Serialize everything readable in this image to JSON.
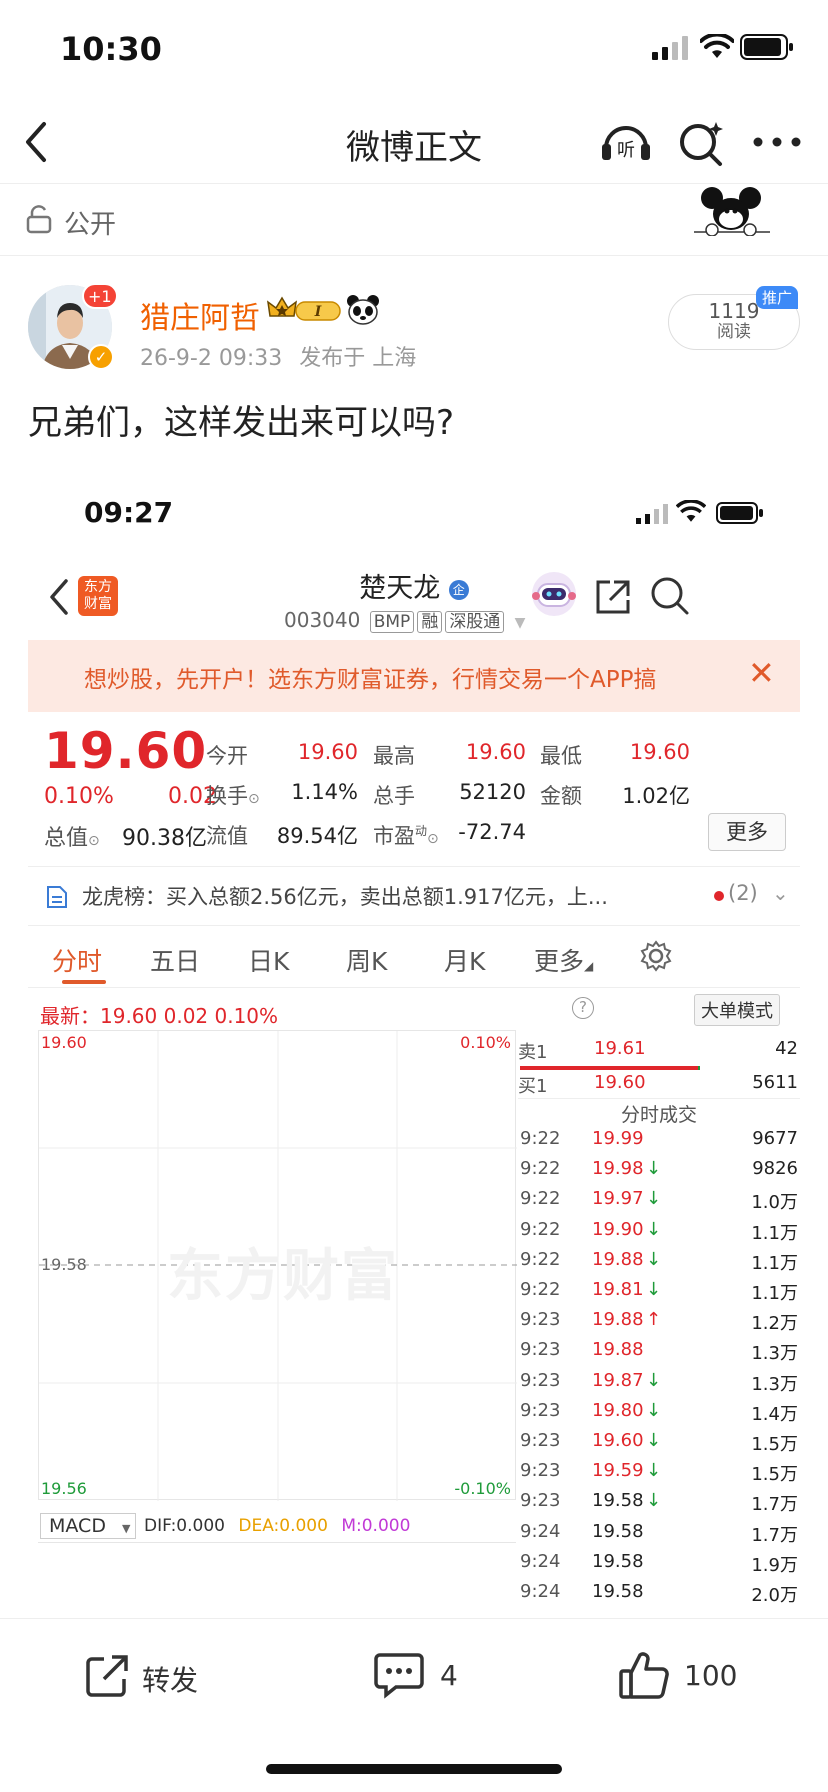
{
  "status_bar": {
    "time": "10:30"
  },
  "nav": {
    "title": "微博正文"
  },
  "post": {
    "visibility": "公开",
    "author": "猎庄阿哲",
    "avatar_badge": "+1",
    "timestamp": "26-9-2 09:33",
    "location": "发布于 上海",
    "read_count": "1119",
    "read_label": "阅读",
    "promo_tag": "推广",
    "text": "兄弟们，这样发出来可以吗?"
  },
  "embedded": {
    "status_time": "09:27",
    "stock": {
      "name": "楚天龙",
      "code": "003040",
      "tags": [
        "BMP",
        "融",
        "深股通"
      ],
      "logo_text": "东方财富"
    },
    "banner": {
      "text": "想炒股，先开户！选东方财富证券，行情交易一个APP搞",
      "close": "✕"
    },
    "quote": {
      "price": "19.60",
      "pct": "0.10%",
      "change": "0.02",
      "total_value_label": "总值",
      "total_value": "90.38亿",
      "fields": [
        {
          "label": "今开",
          "value": "19.60",
          "color": "#e0262b"
        },
        {
          "label": "最高",
          "value": "19.60",
          "color": "#e0262b"
        },
        {
          "label": "最低",
          "value": "19.60",
          "color": "#e0262b"
        },
        {
          "label": "换手",
          "value": "1.14%",
          "color": "#222222"
        },
        {
          "label": "总手",
          "value": "52120",
          "color": "#222222"
        },
        {
          "label": "金额",
          "value": "1.02亿",
          "color": "#222222"
        },
        {
          "label": "流值",
          "value": "89.54亿",
          "color": "#222222"
        },
        {
          "label": "市盈",
          "value": "-72.74",
          "color": "#222222"
        }
      ],
      "more_button": "更多"
    },
    "dragon_tiger": {
      "text": "龙虎榜：买入总额2.56亿元，卖出总额1.917亿元，上...",
      "count": "(2)"
    },
    "tabs": [
      "分时",
      "五日",
      "日K",
      "周K",
      "月K",
      "更多"
    ],
    "latest_line": "最新：19.60  0.02  0.10%",
    "big_order_mode": "大单模式",
    "chart_labels": {
      "top_price": "19.60",
      "mid_price": "19.58",
      "bottom_price": "19.56",
      "top_pct": "0.10%",
      "bottom_pct": "-0.10%",
      "watermark": "东方财富"
    },
    "macd": {
      "select": "MACD",
      "dif": "DIF:0.000",
      "dea": "DEA:0.000",
      "m": "M:0.000"
    },
    "order_book": {
      "sell1": {
        "label": "卖1",
        "price": "19.61",
        "volume": "42"
      },
      "buy1": {
        "label": "买1",
        "price": "19.60",
        "volume": "5611"
      }
    },
    "trades_title": "分时成交",
    "trades": [
      {
        "time": "9:22",
        "price": "19.99",
        "arrow": "",
        "vol": "9677",
        "color": "#e0262b"
      },
      {
        "time": "9:22",
        "price": "19.98",
        "arrow": "↓",
        "vol": "9826",
        "color": "#e0262b"
      },
      {
        "time": "9:22",
        "price": "19.97",
        "arrow": "↓",
        "vol": "1.0万",
        "color": "#e0262b"
      },
      {
        "time": "9:22",
        "price": "19.90",
        "arrow": "↓",
        "vol": "1.1万",
        "color": "#e0262b"
      },
      {
        "time": "9:22",
        "price": "19.88",
        "arrow": "↓",
        "vol": "1.1万",
        "color": "#e0262b"
      },
      {
        "time": "9:22",
        "price": "19.81",
        "arrow": "↓",
        "vol": "1.1万",
        "color": "#e0262b"
      },
      {
        "time": "9:23",
        "price": "19.88",
        "arrow": "↑",
        "vol": "1.2万",
        "color": "#e0262b"
      },
      {
        "time": "9:23",
        "price": "19.88",
        "arrow": "",
        "vol": "1.3万",
        "color": "#e0262b"
      },
      {
        "time": "9:23",
        "price": "19.87",
        "arrow": "↓",
        "vol": "1.3万",
        "color": "#e0262b"
      },
      {
        "time": "9:23",
        "price": "19.80",
        "arrow": "↓",
        "vol": "1.4万",
        "color": "#e0262b"
      },
      {
        "time": "9:23",
        "price": "19.60",
        "arrow": "↓",
        "vol": "1.5万",
        "color": "#e0262b"
      },
      {
        "time": "9:23",
        "price": "19.59",
        "arrow": "↓",
        "vol": "1.5万",
        "color": "#e0262b"
      },
      {
        "time": "9:23",
        "price": "19.58",
        "arrow": "↓",
        "vol": "1.7万",
        "color": "#222222"
      },
      {
        "time": "9:24",
        "price": "19.58",
        "arrow": "",
        "vol": "1.7万",
        "color": "#222222"
      },
      {
        "time": "9:24",
        "price": "19.58",
        "arrow": "",
        "vol": "1.9万",
        "color": "#222222"
      },
      {
        "time": "9:24",
        "price": "19.58",
        "arrow": "",
        "vol": "2.0万",
        "color": "#222222"
      }
    ]
  },
  "actions": {
    "repost": "转发",
    "comment_count": "4",
    "like_count": "100"
  }
}
